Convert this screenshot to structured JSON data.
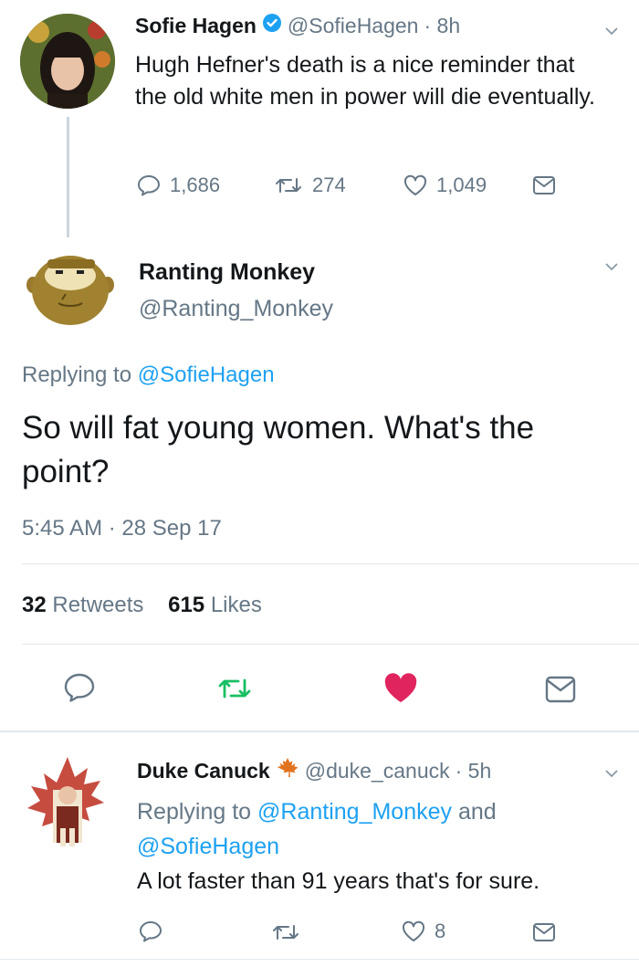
{
  "tweet1": {
    "name": "Sofie Hagen",
    "handle": "@SofieHagen",
    "time": "· 8h",
    "text": "Hugh Hefner's death is a nice reminder that the old white men in power will die eventually.",
    "replies": "1,686",
    "retweets": "274",
    "likes": "1,049"
  },
  "main": {
    "name": "Ranting Monkey",
    "handle": "@Ranting_Monkey",
    "replying_prefix": "Replying to",
    "replying_to": "@SofieHagen",
    "text": "So will fat young women. What's the point?",
    "timestamp": "5:45 AM · 28 Sep 17",
    "retweet_count": "32",
    "retweet_label": "Retweets",
    "like_count": "615",
    "like_label": "Likes"
  },
  "reply": {
    "name": "Duke Canuck",
    "handle": "@duke_canuck",
    "time": "· 5h",
    "replying_prefix": "Replying to",
    "replying_to_1": "@Ranting_Monkey",
    "replying_and": "and",
    "replying_to_2": "@SofieHagen",
    "text": "A lot faster than 91 years that's for sure.",
    "likes": "8"
  },
  "colors": {
    "link": "#1da1f2",
    "muted": "#657786",
    "retweet_green": "#17bf63",
    "like_red": "#e0245e",
    "verified": "#1da1f2",
    "maple": "#e2731e"
  },
  "icons": [
    "chevron-down-icon",
    "reply-icon",
    "retweet-icon",
    "like-icon",
    "dm-icon",
    "verified-badge-icon",
    "maple-leaf-icon"
  ]
}
